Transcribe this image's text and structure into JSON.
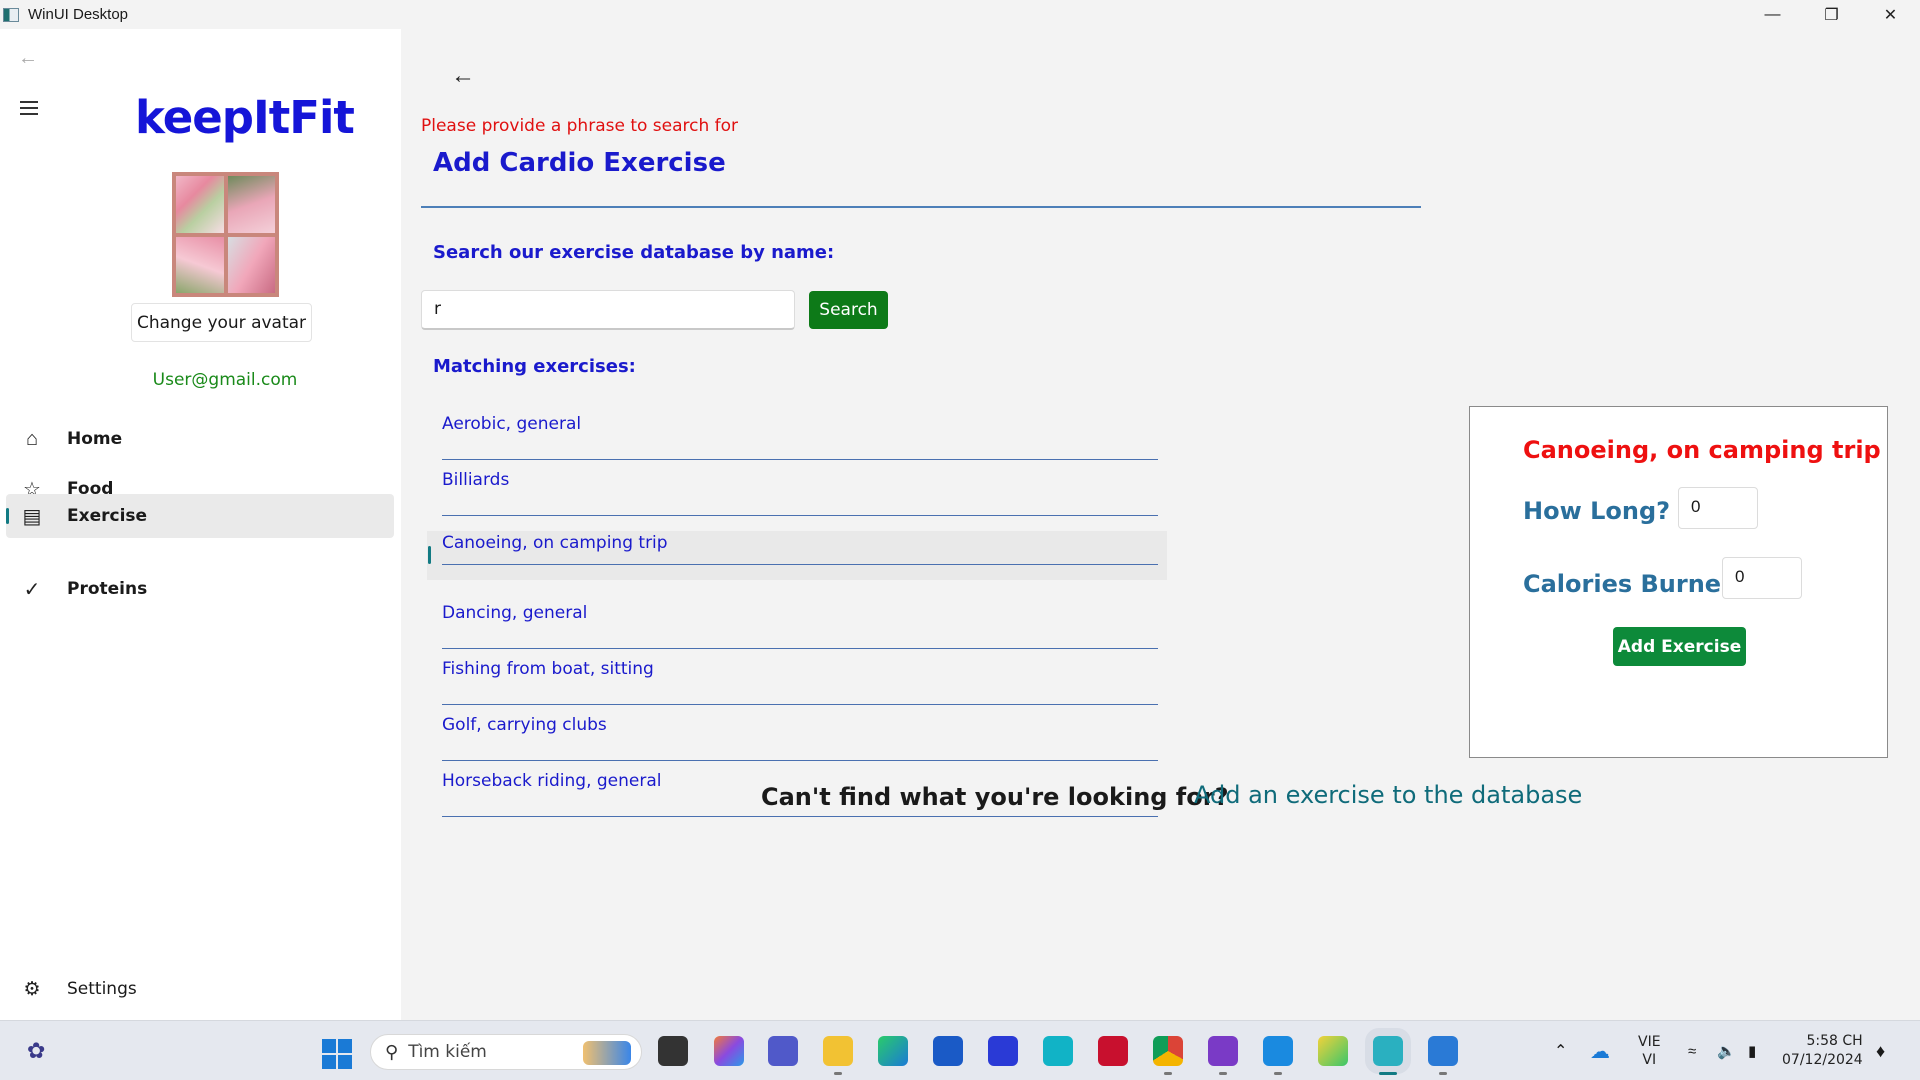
{
  "window": {
    "title": "WinUI Desktop"
  },
  "sidebar": {
    "logo": "keepItFit",
    "change_avatar": "Change your avatar",
    "email": "User@gmail.com",
    "items": [
      {
        "label": "Home",
        "icon": "home-icon"
      },
      {
        "label": "Food",
        "icon": "star-icon"
      },
      {
        "label": "Exercise",
        "icon": "exercise-icon",
        "selected": true
      },
      {
        "label": "Proteins",
        "icon": "checkmark-icon"
      }
    ],
    "settings": "Settings"
  },
  "main": {
    "error": "Please provide a phrase to search for",
    "title": "Add Cardio Exercise",
    "search_label": "Search our exercise database by name:",
    "search_value": "r",
    "search_button": "Search",
    "matching_label": "Matching exercises:",
    "exercises": [
      "Aerobic, general",
      "Billiards",
      "Canoeing, on camping trip",
      "Dancing, general",
      "Fishing from boat, sitting",
      "Golf, carrying clubs",
      "Horseback riding, general"
    ],
    "selected_exercise_index": 2,
    "cant_find": "Can't find what you're looking for?",
    "add_to_db_link": "Add an exercise to the database"
  },
  "detail": {
    "title": "Canoeing, on camping trip",
    "how_long_label": "How Long?",
    "how_long_value": "0",
    "calories_label": "Calories Burned",
    "calories_value": "0",
    "add_button": "Add Exercise"
  },
  "taskbar": {
    "search_placeholder": "Tìm kiếm",
    "lang_top": "VIE",
    "lang_bottom": "VI",
    "time": "5:58 CH",
    "date": "07/12/2024"
  },
  "colors": {
    "accent": "#127a83",
    "title_blue": "#1a1acc",
    "error_red": "#e01010",
    "search_green": "#0d7a18",
    "add_green": "#0d8a3a"
  }
}
